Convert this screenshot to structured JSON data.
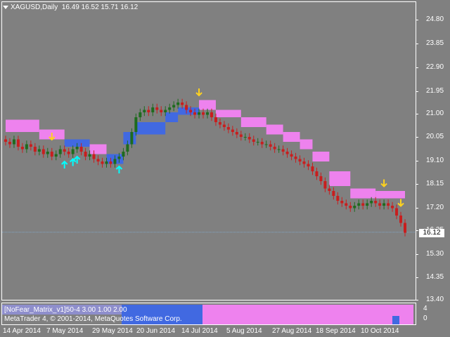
{
  "header": {
    "symbol": "XAGUSD,Daily",
    "ohlc": "16.49 16.52 15.71 16.12"
  },
  "price_axis": [
    "24.80",
    "23.85",
    "22.90",
    "21.95",
    "21.00",
    "20.05",
    "19.10",
    "18.15",
    "17.20",
    "16.25",
    "15.30",
    "14.35",
    "13.40"
  ],
  "last_price": "16.12",
  "time_axis": [
    "14 Apr 2014",
    "7 May 2014",
    "29 May 2014",
    "20 Jun 2014",
    "14 Jul 2014",
    "5 Aug 2014",
    "27 Aug 2014",
    "18 Sep 2014",
    "10 Oct 2014"
  ],
  "indicator": {
    "label": "[NoFear_Matrix_v1]50-4 3.00 1.00 2.00",
    "axis": [
      "4",
      "0"
    ]
  },
  "copyright": "MetaTrader 4, © 2001-2014, MetaQuotes Software Corp.",
  "colors": {
    "background": "#808080",
    "bull": "#1e6b1e",
    "bear": "#c81e1e",
    "band_upper": "#ee82ee",
    "band_lower": "#4169e1",
    "arrow_up": "#00ffff",
    "arrow_down": "#ffd21e"
  },
  "chart_data": {
    "type": "candlestick",
    "symbol": "XAGUSD",
    "timeframe": "Daily",
    "ylim": [
      13.4,
      24.8
    ],
    "closes": [
      19.8,
      19.7,
      19.9,
      19.6,
      19.5,
      19.7,
      19.6,
      19.4,
      19.5,
      19.3,
      19.4,
      19.2,
      19.3,
      19.5,
      19.4,
      19.3,
      19.5,
      19.6,
      19.4,
      19.2,
      19.3,
      19.1,
      19.0,
      18.9,
      19.0,
      18.9,
      19.1,
      19.2,
      19.4,
      19.7,
      20.2,
      20.8,
      21.0,
      21.1,
      21.0,
      21.2,
      21.1,
      21.0,
      21.1,
      21.2,
      21.3,
      21.4,
      21.3,
      21.1,
      21.0,
      20.9,
      21.0,
      20.9,
      21.0,
      20.8,
      20.6,
      20.5,
      20.4,
      20.3,
      20.2,
      20.1,
      20.0,
      20.0,
      19.9,
      19.8,
      19.8,
      19.7,
      19.7,
      19.6,
      19.5,
      19.5,
      19.4,
      19.3,
      19.2,
      19.1,
      19.0,
      18.9,
      18.8,
      18.6,
      18.4,
      18.2,
      17.9,
      17.8,
      17.6,
      17.4,
      17.3,
      17.2,
      17.1,
      17.2,
      17.3,
      17.2,
      17.3,
      17.4,
      17.3,
      17.2,
      17.3,
      17.2,
      17.1,
      16.8,
      16.5,
      16.1
    ]
  }
}
